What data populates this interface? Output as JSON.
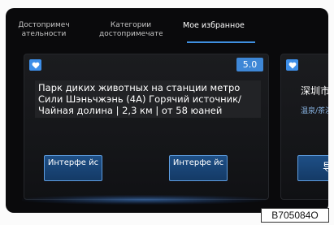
{
  "tabs": [
    {
      "label": "Достопримеч ательности"
    },
    {
      "label": "Категории достопримечате"
    },
    {
      "label": "Мое избранное"
    }
  ],
  "card1": {
    "rating": "5.0",
    "info": "Парк диких животных на станции метро Сили Шэньчжэнь (4А) Горячий источник/Чайная долина | 2,3 км | от 58 юаней",
    "button1": "Интерфе йс",
    "button2": "Интерфе йс"
  },
  "card2": {
    "title": "深圳市西",
    "subtitle": "温泉/茶溪",
    "button": "导"
  },
  "figure_code": "B705084O",
  "colors": {
    "accent": "#3d8ee8",
    "background": "#0a0a0c"
  }
}
